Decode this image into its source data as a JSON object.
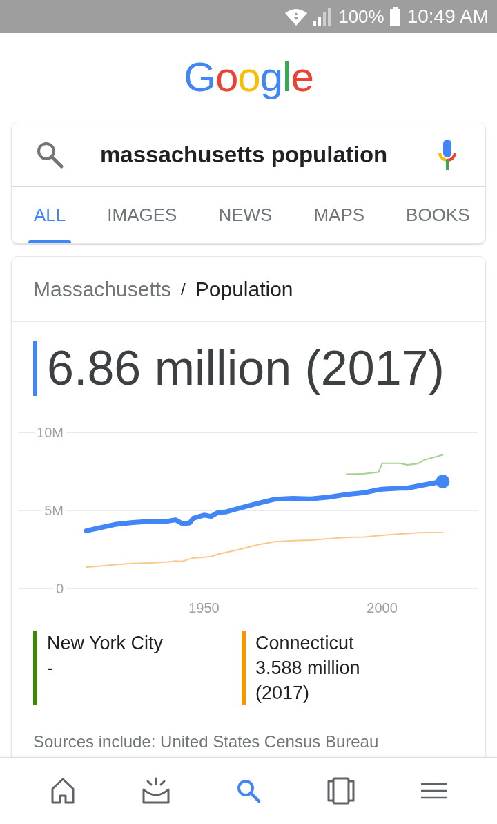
{
  "status_bar": {
    "battery": "100%",
    "time": "10:49 AM"
  },
  "logo": "Google",
  "search": {
    "query": "massachusetts population"
  },
  "tabs": [
    {
      "label": "ALL",
      "selected": true
    },
    {
      "label": "IMAGES",
      "selected": false
    },
    {
      "label": "NEWS",
      "selected": false
    },
    {
      "label": "MAPS",
      "selected": false
    },
    {
      "label": "BOOKS",
      "selected": false
    }
  ],
  "result": {
    "breadcrumb": {
      "parent": "Massachusetts",
      "separator": "/",
      "current": "Population"
    },
    "value": "6.86 million (2017)",
    "chart_data": {
      "type": "line",
      "x": [
        1917,
        1920,
        1925,
        1930,
        1935,
        1940,
        1942,
        1944,
        1946,
        1947,
        1950,
        1952,
        1954,
        1956,
        1960,
        1965,
        1970,
        1975,
        1980,
        1985,
        1990,
        1995,
        1999,
        2000,
        2005,
        2007,
        2010,
        2012,
        2017
      ],
      "series": [
        {
          "color": "#4285f4",
          "values": [
            3.7,
            3.85,
            4.1,
            4.22,
            4.3,
            4.32,
            4.4,
            4.15,
            4.2,
            4.5,
            4.7,
            4.62,
            4.88,
            4.9,
            5.15,
            5.45,
            5.72,
            5.78,
            5.74,
            5.85,
            6.02,
            6.14,
            6.33,
            6.36,
            6.43,
            6.43,
            6.56,
            6.65,
            6.86
          ]
        },
        {
          "color": "#a5d28f",
          "values": [
            null,
            null,
            null,
            null,
            null,
            null,
            null,
            null,
            null,
            null,
            null,
            null,
            null,
            null,
            null,
            null,
            null,
            null,
            null,
            null,
            7.32,
            7.36,
            7.45,
            8.02,
            8.02,
            7.92,
            8.0,
            8.25,
            8.56
          ]
        },
        {
          "color": "#f8c98d",
          "values": [
            1.37,
            1.42,
            1.52,
            1.6,
            1.64,
            1.7,
            1.76,
            1.74,
            1.9,
            1.95,
            2.0,
            2.05,
            2.2,
            2.3,
            2.5,
            2.8,
            3.0,
            3.06,
            3.1,
            3.18,
            3.28,
            3.3,
            3.38,
            3.41,
            3.5,
            3.52,
            3.57,
            3.59,
            3.59
          ]
        }
      ],
      "xlim": [
        1898,
        2027
      ],
      "ylim": [
        0,
        10
      ],
      "xticks": [
        1950,
        2000
      ],
      "yticks": [
        {
          "value": 0,
          "label": "0"
        },
        {
          "value": 5,
          "label": "5M"
        },
        {
          "value": 10,
          "label": "10M"
        }
      ]
    },
    "legend": [
      {
        "name": "New York City",
        "value": "-",
        "color": "#3a8a07"
      },
      {
        "name": "Connecticut",
        "value": "3.588 million (2017)",
        "color": "#f29900"
      }
    ],
    "sources": "Sources include: United States Census Bureau"
  },
  "bottom_nav": [
    {
      "kind": "home",
      "selected": false
    },
    {
      "kind": "updates",
      "selected": false
    },
    {
      "kind": "search",
      "selected": true
    },
    {
      "kind": "tabs",
      "selected": false
    },
    {
      "kind": "menu",
      "selected": false
    }
  ]
}
